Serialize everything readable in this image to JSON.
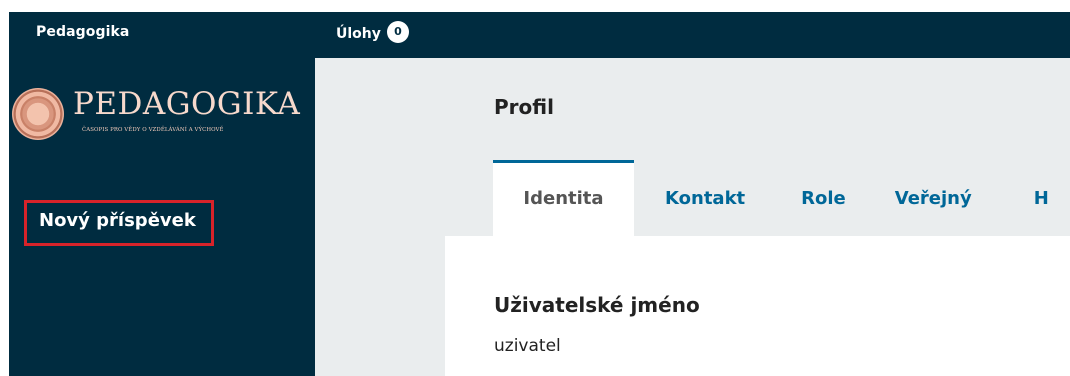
{
  "topbar": {
    "site_name": "Pedagogika",
    "tasks_label": "Úlohy",
    "tasks_count": "0"
  },
  "sidebar": {
    "logo_title": "PEDAGOGIKA",
    "logo_subtitle": "ČASOPIS PRO VĚDY O VZDĚLÁVÁNÍ A VÝCHOVĚ",
    "new_submission_label": "Nový příspěvek"
  },
  "main": {
    "page_title": "Profil",
    "tabs": [
      {
        "label": "Identita"
      },
      {
        "label": "Kontakt"
      },
      {
        "label": "Role"
      },
      {
        "label": "Veřejný"
      },
      {
        "label": "H"
      }
    ],
    "username_label": "Uživatelské jméno",
    "username_value": "uzivatel"
  },
  "colors": {
    "nav_background": "#002c40",
    "accent": "#006798",
    "highlight_box": "#d8232a",
    "main_background": "#eaedee"
  }
}
